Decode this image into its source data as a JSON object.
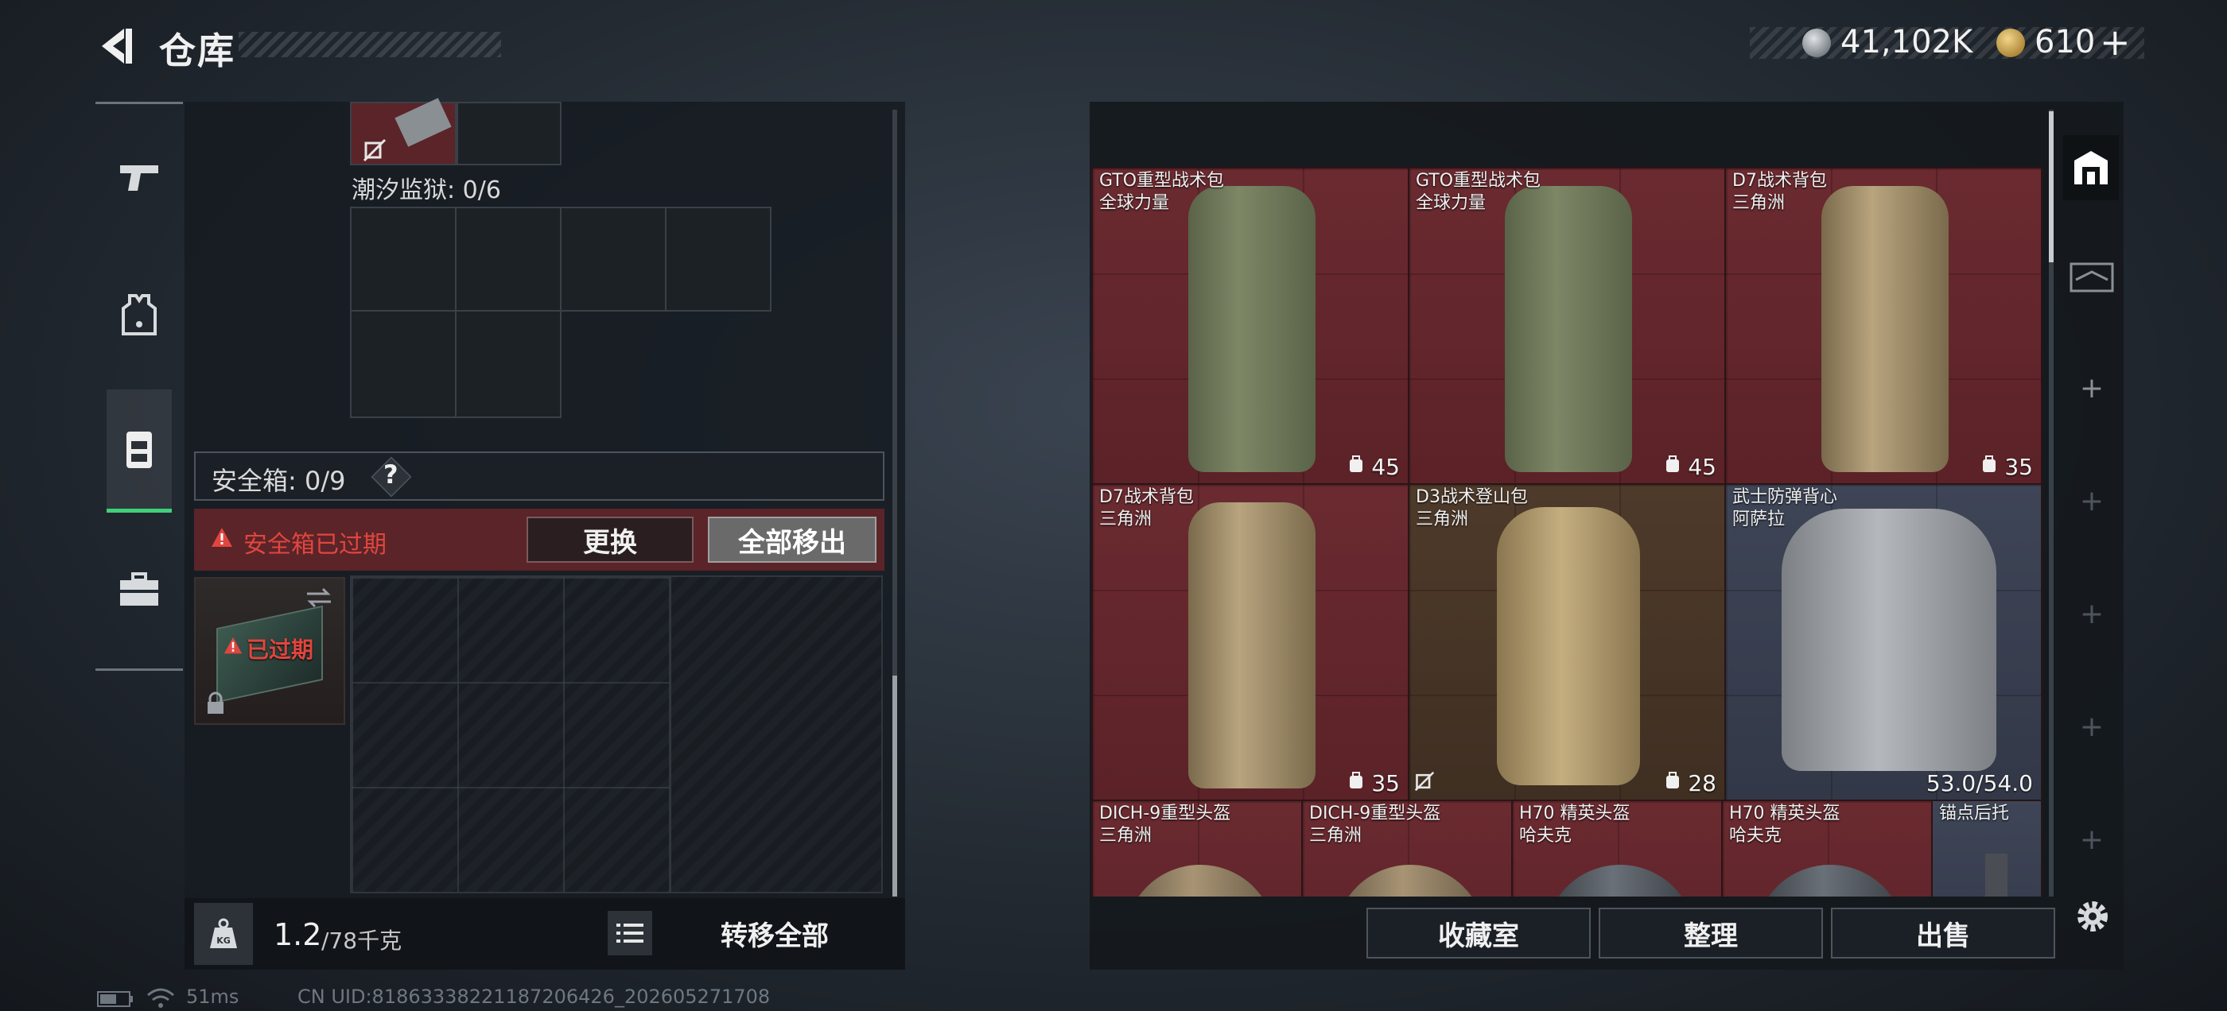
{
  "header": {
    "title": "仓库",
    "currency": [
      {
        "icon": "silver-coin-icon",
        "value": "41,102K"
      },
      {
        "icon": "gold-coin-icon",
        "value": "610"
      }
    ],
    "add_symbol": "+"
  },
  "left_rail": {
    "items": [
      {
        "name": "weapon",
        "icon": "pistol-icon"
      },
      {
        "name": "armor",
        "icon": "vest-icon"
      },
      {
        "name": "backpack",
        "icon": "backpack-icon",
        "active": true
      },
      {
        "name": "case",
        "icon": "briefcase-icon"
      }
    ]
  },
  "left_panel": {
    "container_label": "潮汐监狱: 0/6",
    "safebox_label": "安全箱: 0/9",
    "help_symbol": "?",
    "expired_warning": "安全箱已过期",
    "swap_button": "更换",
    "move_all_button": "全部移出",
    "safebox_expired_badge": "已过期",
    "weight_value": "1.2",
    "weight_max": "/78千克",
    "transfer_all_button": "转移全部"
  },
  "items": [
    {
      "name": "GTO重型战术包",
      "brand": "全球力量",
      "count": "45",
      "color": "red"
    },
    {
      "name": "GTO重型战术包",
      "brand": "全球力量",
      "count": "45",
      "color": "red"
    },
    {
      "name": "D7战术背包",
      "brand": "三角洲",
      "count": "35",
      "color": "red"
    },
    {
      "name": "D7战术背包",
      "brand": "三角洲",
      "count": "35",
      "color": "red"
    },
    {
      "name": "D3战术登山包",
      "brand": "三角洲",
      "count": "28",
      "color": "brown"
    },
    {
      "name": "武士防弹背心",
      "brand": "阿萨拉",
      "count": "53.0/54.0",
      "color": "blue"
    },
    {
      "name": "DICH-9重型头盔",
      "brand": "三角洲",
      "count": "",
      "color": "red"
    },
    {
      "name": "DICH-9重型头盔",
      "brand": "三角洲",
      "count": "",
      "color": "red"
    },
    {
      "name": "H70 精英头盔",
      "brand": "哈夫克",
      "count": "",
      "color": "red"
    },
    {
      "name": "H70 精英头盔",
      "brand": "哈夫克",
      "count": "",
      "color": "red"
    },
    {
      "name": "锚点后托",
      "brand": "",
      "count": "",
      "color": "blue"
    }
  ],
  "right_buttons": {
    "collection": "收藏室",
    "organize": "整理",
    "sell": "出售"
  },
  "status_bar": {
    "ping": "51ms",
    "uid": "CN UID:81863338221187206426_202605271708"
  },
  "colors": {
    "accent_green": "#3fd07a",
    "warning_red": "#e0463f",
    "item_red": "#6a2a30",
    "item_brown": "#4e3a2a",
    "item_blue": "#3e4556"
  }
}
